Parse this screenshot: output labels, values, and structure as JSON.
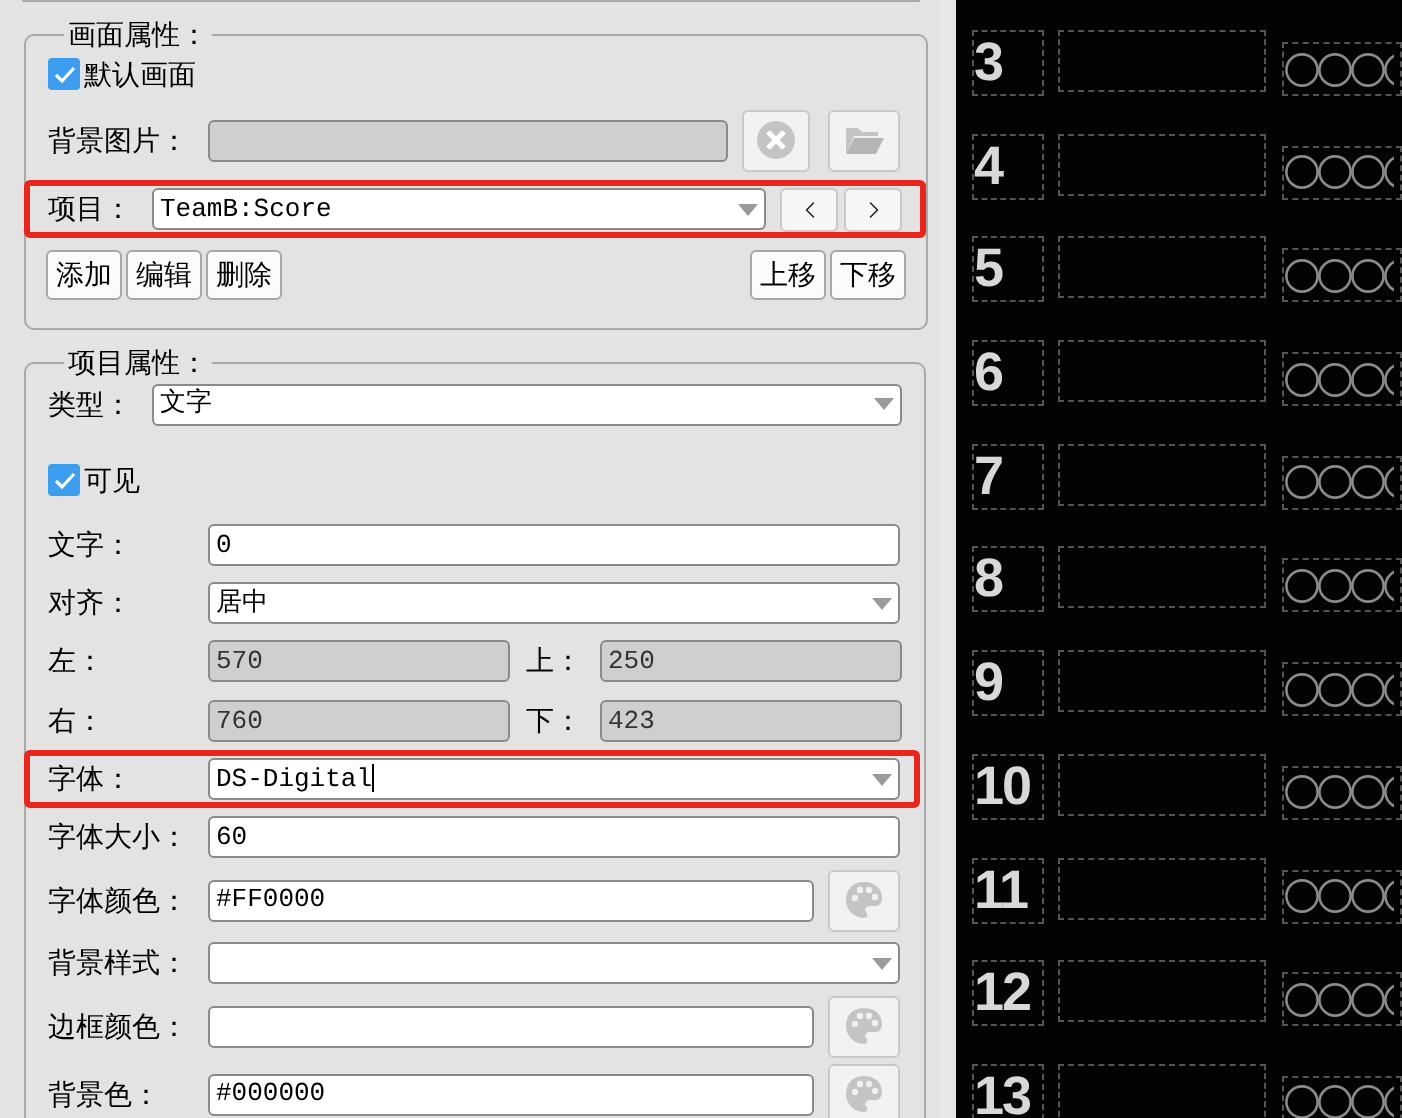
{
  "screen_properties": {
    "title": "画面属性：",
    "default_screen": {
      "label": "默认画面",
      "checked": true
    },
    "background_image": {
      "label": "背景图片："
    },
    "item": {
      "label": "项目：",
      "value": "TeamB:Score",
      "highlighted": true
    },
    "buttons_left": [
      "添加",
      "编辑",
      "删除"
    ],
    "buttons_right": [
      "上移",
      "下移"
    ]
  },
  "item_properties": {
    "title": "项目属性：",
    "type": {
      "label": "类型：",
      "value": "文字"
    },
    "visible": {
      "label": "可见",
      "checked": true
    },
    "fields": [
      {
        "kind": "text",
        "label": "文字：",
        "value": "0"
      },
      {
        "kind": "select",
        "label": "对齐：",
        "value": "居中"
      },
      {
        "kind": "pair",
        "items": [
          {
            "label": "左：",
            "value": "570",
            "disabled": true
          },
          {
            "label": "上：",
            "value": "250",
            "disabled": true
          }
        ]
      },
      {
        "kind": "pair",
        "items": [
          {
            "label": "右：",
            "value": "760",
            "disabled": true
          },
          {
            "label": "下：",
            "value": "423",
            "disabled": true
          }
        ]
      },
      {
        "kind": "select",
        "label": "字体：",
        "value": "DS-Digital",
        "highlighted": true,
        "focused": true
      },
      {
        "kind": "text",
        "label": "字体大小：",
        "value": "60"
      },
      {
        "kind": "color",
        "label": "字体颜色：",
        "value": "#FF0000"
      },
      {
        "kind": "select",
        "label": "背景样式："
      },
      {
        "kind": "color",
        "label": "边框颜色："
      },
      {
        "kind": "color",
        "label": "背景色：",
        "value": "#000000"
      }
    ]
  },
  "preview_rows": [
    {
      "number": "3"
    },
    {
      "number": "4"
    },
    {
      "number": "5"
    },
    {
      "number": "6"
    },
    {
      "number": "7"
    },
    {
      "number": "8"
    },
    {
      "number": "9"
    },
    {
      "number": "10"
    },
    {
      "number": "11"
    },
    {
      "number": "12"
    },
    {
      "number": "13"
    }
  ]
}
